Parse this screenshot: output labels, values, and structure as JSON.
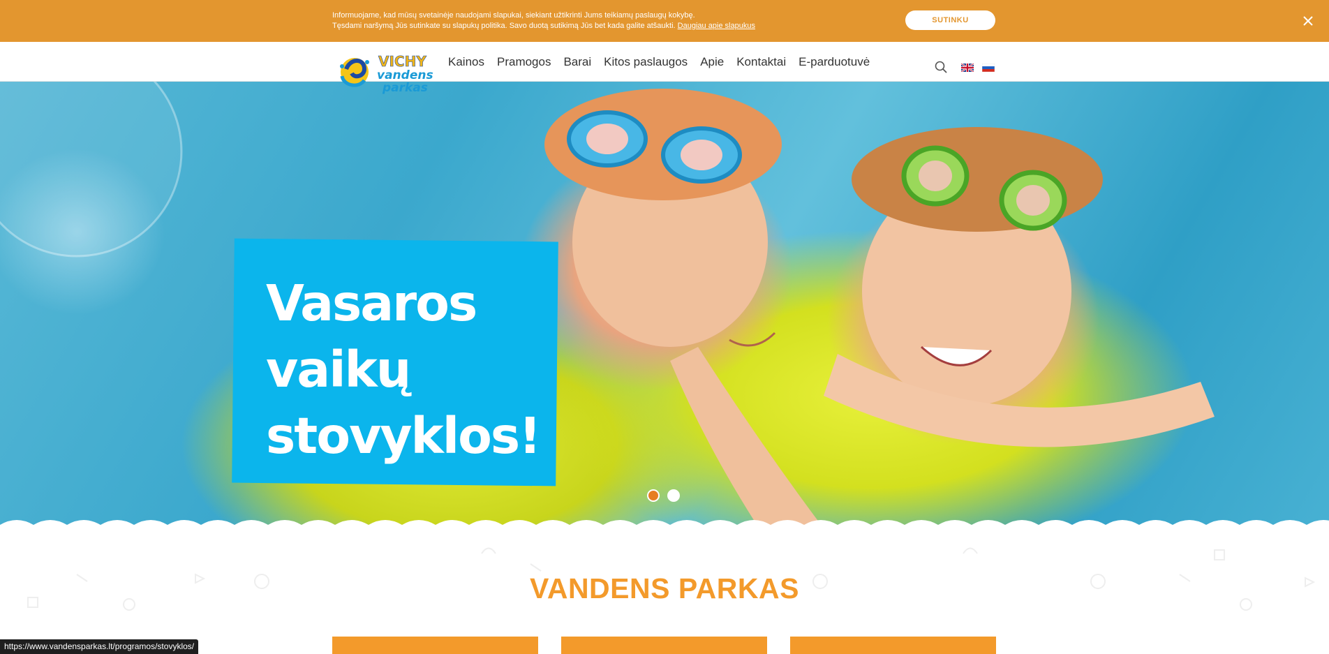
{
  "cookie_banner": {
    "line1": "Informuojame, kad mūsų svetainėje naudojami slapukai, siekiant užtikrinti Jums teikiamų paslaugų kokybę.",
    "line2": "Tęsdami naršymą Jūs sutinkate su slapukų politika. Savo duotą sutikimą Jūs bet kada galite atšaukti.",
    "link": "Daugiau apie slapukus",
    "accept_label": "SUTINKU",
    "close_icon": "close-icon"
  },
  "header": {
    "logo": {
      "line1": "VICHY",
      "line2": "vandens",
      "line3": "parkas"
    },
    "nav": [
      "Kainos",
      "Pramogos",
      "Barai",
      "Kitos paslaugos",
      "Apie",
      "Kontaktai",
      "E-parduotuvė"
    ],
    "search_icon": "search-icon",
    "languages": [
      "en-flag-icon",
      "ru-flag-icon"
    ]
  },
  "hero": {
    "heading_lines": [
      "Vasaros",
      "vaikų",
      "stovyklos!"
    ],
    "slide_count": 2,
    "active_slide": 1
  },
  "section": {
    "title": "VANDENS PARKAS"
  },
  "status_bar": {
    "url": "https://www.vandensparkas.lt/programos/stovyklos/"
  },
  "colors": {
    "banner_orange": "#e3962f",
    "accent_orange": "#f39a2b",
    "hero_blue": "#0bb5ec"
  }
}
